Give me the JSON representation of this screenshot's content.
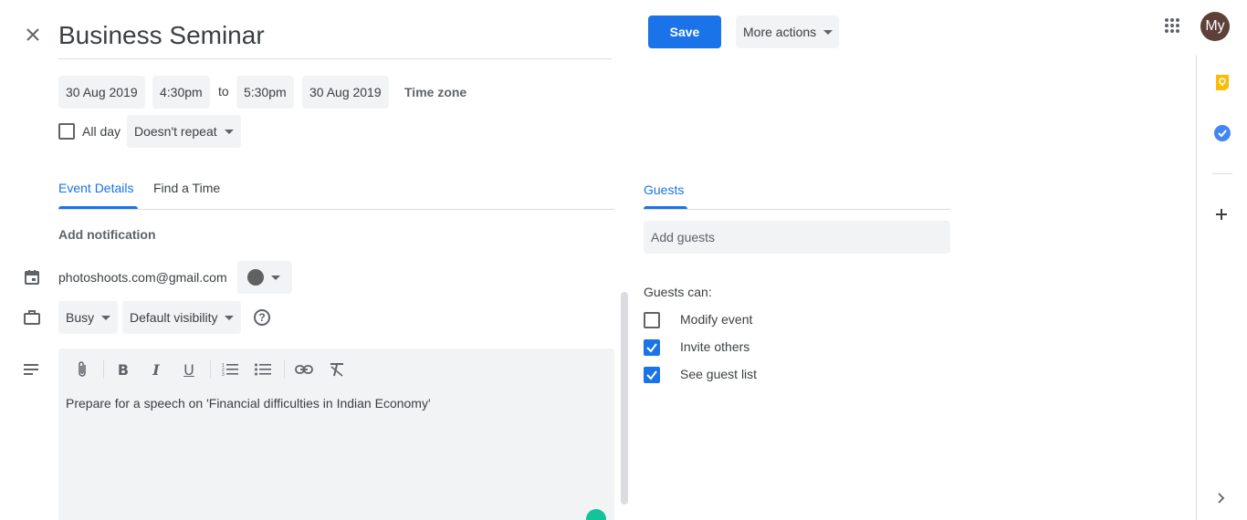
{
  "header": {
    "title": "Business Seminar",
    "save_label": "Save",
    "more_actions_label": "More actions",
    "avatar_initials": "My"
  },
  "datetime": {
    "start_date": "30 Aug 2019",
    "start_time": "4:30pm",
    "to_label": "to",
    "end_time": "5:30pm",
    "end_date": "30 Aug 2019",
    "timezone_label": "Time zone",
    "all_day_label": "All day",
    "all_day_checked": false,
    "repeat_label": "Doesn't repeat"
  },
  "tabs": [
    {
      "label": "Event Details",
      "active": true
    },
    {
      "label": "Find a Time",
      "active": false
    }
  ],
  "details": {
    "add_notification_label": "Add notification",
    "calendar_email": "photoshoots.com@gmail.com",
    "calendar_color": "#616161",
    "busy_label": "Busy",
    "visibility_label": "Default visibility",
    "description": "Prepare for a speech on 'Financial difficulties in Indian Economy'"
  },
  "guests": {
    "title": "Guests",
    "add_placeholder": "Add guests",
    "permissions_label": "Guests can:",
    "permissions": [
      {
        "label": "Modify event",
        "checked": false
      },
      {
        "label": "Invite others",
        "checked": true
      },
      {
        "label": "See guest list",
        "checked": true
      }
    ]
  },
  "colors": {
    "accent": "#1a73e8",
    "keep": "#fbbc04",
    "tasks": "#4285f4",
    "avatar_bg": "#5d4037",
    "grammarly": "#15c39a"
  }
}
